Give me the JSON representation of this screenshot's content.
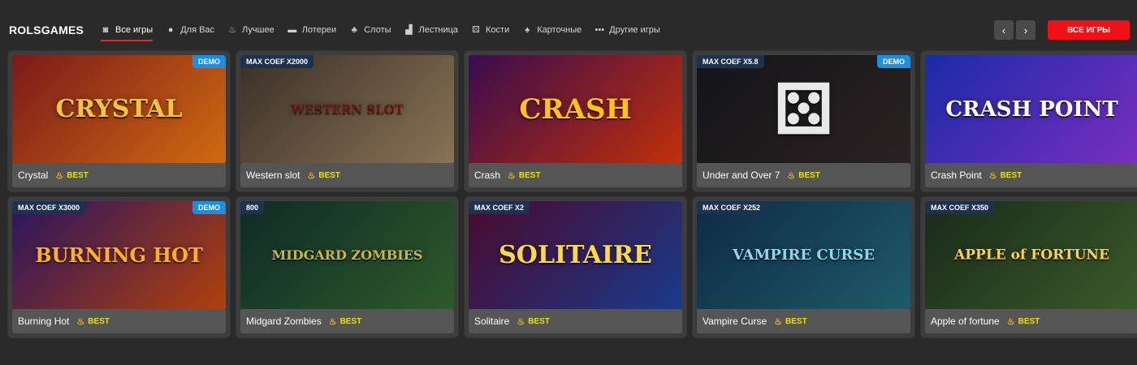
{
  "brand": "ROLSGAMES",
  "nav": [
    {
      "label": "Все игры",
      "icon": "gamepad-icon",
      "glyph": "◙"
    },
    {
      "label": "Для Вас",
      "icon": "user-icon",
      "glyph": "●"
    },
    {
      "label": "Лучшее",
      "icon": "flame-icon",
      "glyph": "♨"
    },
    {
      "label": "Лотереи",
      "icon": "ticket-icon",
      "glyph": "▬"
    },
    {
      "label": "Слоты",
      "icon": "cherries-icon",
      "glyph": "♣"
    },
    {
      "label": "Лестница",
      "icon": "ladder-icon",
      "glyph": "▟"
    },
    {
      "label": "Кости",
      "icon": "dice-icon",
      "glyph": "⚄"
    },
    {
      "label": "Карточные",
      "icon": "spade-icon",
      "glyph": "♠"
    },
    {
      "label": "Другие игры",
      "icon": "more-icon",
      "glyph": "•••"
    }
  ],
  "controls": {
    "prev_glyph": "‹",
    "next_glyph": "›",
    "all_games": "ВСЕ ИГРЫ"
  },
  "best_label": "BEST",
  "games": [
    {
      "name": "Crystal",
      "coef": "",
      "demo": "DEMO",
      "art": "CRYSTAL",
      "bg1": "#7a1a1a",
      "bg2": "#d06a10",
      "fg": "#f5c542"
    },
    {
      "name": "Western slot",
      "coef": "MAX COEF X2000",
      "demo": "",
      "art": "WESTERN SLOT",
      "bg1": "#3a3028",
      "bg2": "#8a7355",
      "fg": "#6a1a10"
    },
    {
      "name": "Crash",
      "coef": "",
      "demo": "",
      "art": "CRASH",
      "bg1": "#3a0b4e",
      "bg2": "#c0300a",
      "fg": "#ffc21a"
    },
    {
      "name": "Under and Over 7",
      "coef": "MAX COEF X5.8",
      "demo": "DEMO",
      "art": "⚄",
      "bg1": "#141419",
      "bg2": "#2a2222",
      "fg": "#e8e8e8"
    },
    {
      "name": "Crash Point",
      "coef": "",
      "demo": "",
      "art": "CRASH POINT",
      "bg1": "#1a2ba8",
      "bg2": "#7a2ec0",
      "fg": "#ffffff"
    },
    {
      "name": "Burning Hot",
      "coef": "MAX COEF X3000",
      "demo": "DEMO",
      "art": "BURNING HOT",
      "bg1": "#2a1460",
      "bg2": "#b0400c",
      "fg": "#ffb020"
    },
    {
      "name": "Midgard Zombies",
      "coef": "800",
      "demo": "",
      "art": "MIDGARD ZOMBIES",
      "bg1": "#0f2a26",
      "bg2": "#2e5a2a",
      "fg": "#c9b44a"
    },
    {
      "name": "Solitaire",
      "coef": "MAX COEF X2",
      "demo": "",
      "art": "SOLITAIRE",
      "bg1": "#4a0a2e",
      "bg2": "#1a3a8a",
      "fg": "#ffd84a"
    },
    {
      "name": "Vampire Curse",
      "coef": "MAX COEF X252",
      "demo": "",
      "art": "VAMPIRE CURSE",
      "bg1": "#0e2a44",
      "bg2": "#1e5a6a",
      "fg": "#8ad8e8"
    },
    {
      "name": "Apple of fortune",
      "coef": "MAX COEF X350",
      "demo": "",
      "art": "APPLE of FORTUNE",
      "bg1": "#1a2a1a",
      "bg2": "#3a5a2a",
      "fg": "#ffd24a"
    }
  ]
}
